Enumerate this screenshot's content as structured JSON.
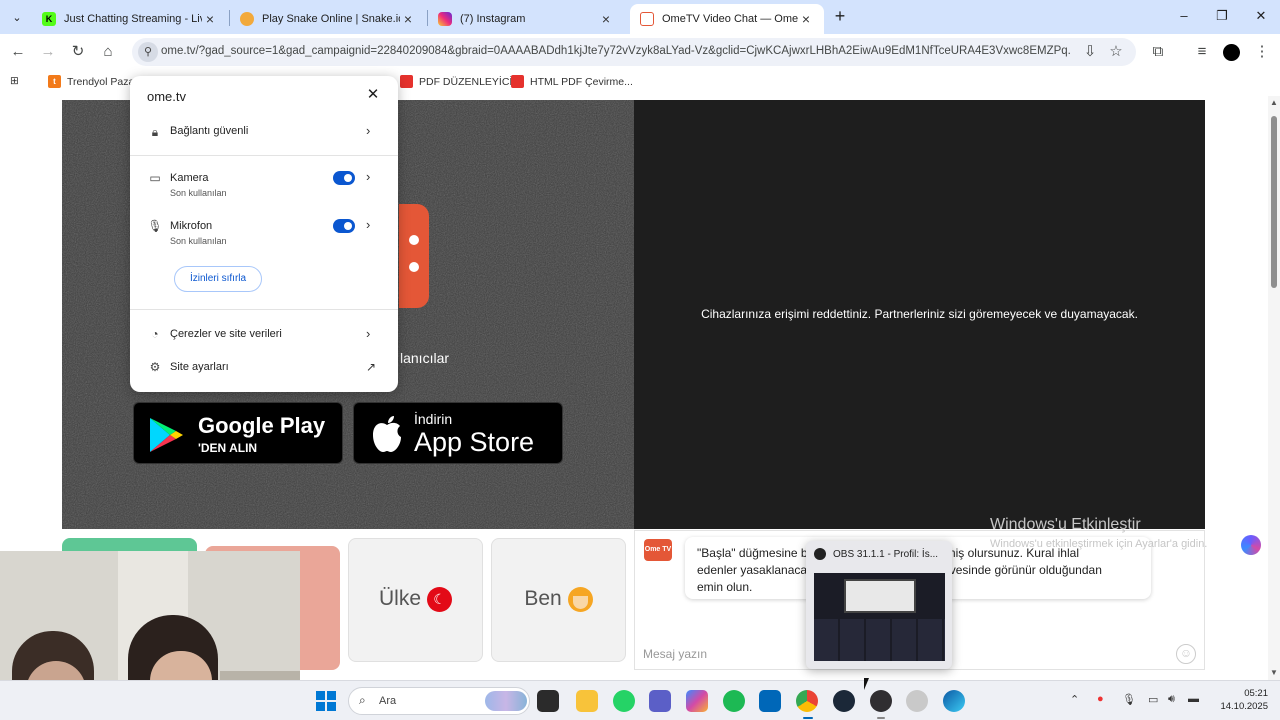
{
  "tabs": [
    {
      "title": "Just Chatting Streaming - Live S",
      "icon": "kick-icon",
      "color": "#53fc18",
      "active": false
    },
    {
      "title": "Play Snake Online | Snake.io",
      "icon": "snake-icon",
      "color": "#f2a93b",
      "active": false
    },
    {
      "title": "(7) Instagram",
      "icon": "instagram-icon",
      "color": "#e1306c",
      "active": false
    },
    {
      "title": "OmeTV Video Chat — Omegle",
      "icon": "ometv-icon",
      "color": "#e45737",
      "active": true
    }
  ],
  "address_bar": {
    "url": "ome.tv/?gad_source=1&gad_campaignid=22840209084&gbraid=0AAAABADdh1kjJte7y72vVzyk8aLYad-Vz&gclid=CjwKCAjwxrLHBhA2EiwAu9EdM1NfTceURA4E3Vxwc8EMZPq..."
  },
  "bookmarks": [
    {
      "label": "Trendyol Pazar",
      "color": "#f27a1a"
    },
    {
      "label": "PDF DÜZENLEYİCİ",
      "color": "#e5322d"
    },
    {
      "label": "HTML PDF Çevirme...",
      "color": "#e5322d"
    }
  ],
  "permission_popup": {
    "site": "ome.tv",
    "connection": "Bağlantı güvenli",
    "camera": {
      "label": "Kamera",
      "sub": "Son kullanılan",
      "enabled": true
    },
    "microphone": {
      "label": "Mikrofon",
      "sub": "Son kullanılan",
      "enabled": true
    },
    "reset_button": "İzinleri sıfırla",
    "cookies": "Çerezler ve site verileri",
    "site_settings": "Site ayarları"
  },
  "page": {
    "users_text": "lanıcılar",
    "google_play": {
      "line1": "Google Play",
      "line2": "'DEN ALIN"
    },
    "app_store": {
      "line1": "İndirin",
      "line2": "App Store"
    },
    "denied_message": "Cihazlarınıza erişimi reddettiniz. Partnerleriniz sizi göremeyecek ve duyamayacak.",
    "country_tile": "Ülke",
    "me_tile": "Ben",
    "chat": {
      "logo_text": "Ome TV",
      "bubble_line1": "\"Başla\" düğmesine b",
      "bubble_line1_right": "l etmiş olursunuz. Kural ihlal",
      "bubble_line2": "edenler yasaklanaca",
      "bubble_line2_right": "rçevesinde görünür olduğundan",
      "bubble_line3": "emin olun.",
      "input_placeholder": "Mesaj yazın"
    },
    "windows_activate": {
      "title": "Windows'u Etkinleştir",
      "subtitle": "Windows'u etkinleştirmek için Ayarlar'a gidin."
    }
  },
  "obs_popup": {
    "title": "OBS 31.1.1 - Profil: İs..."
  },
  "taskbar": {
    "search_placeholder": "Ara",
    "time": "05:21",
    "date": "14.10.2025"
  }
}
